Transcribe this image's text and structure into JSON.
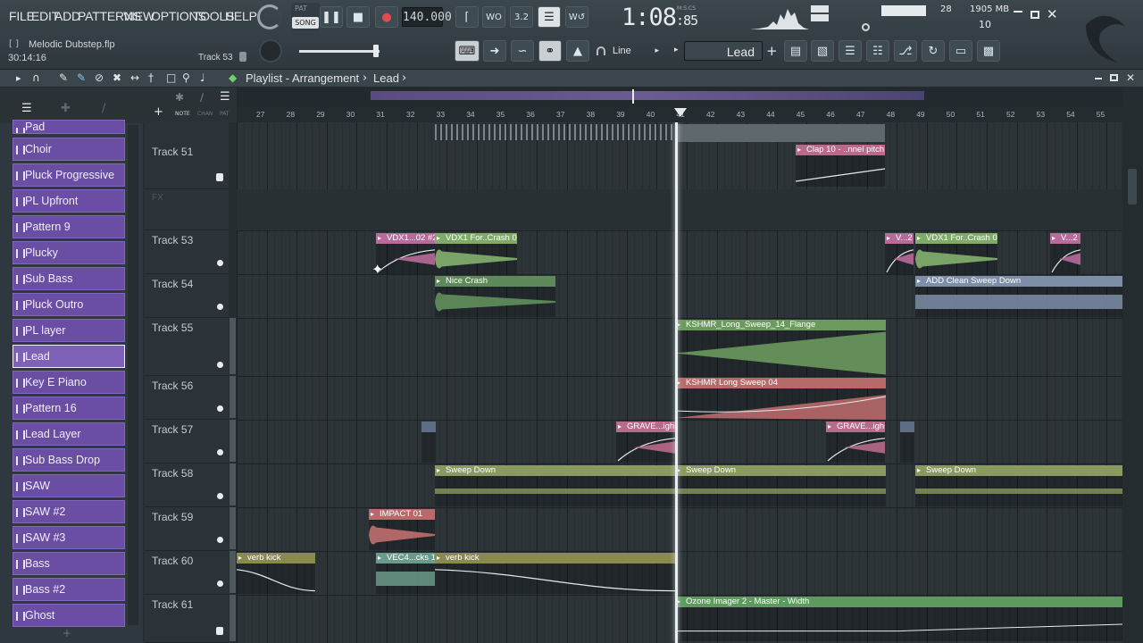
{
  "menu": [
    "FILE",
    "EDIT",
    "ADD",
    "PATTERNS",
    "VIEW",
    "OPTIONS",
    "TOOLS",
    "HELP"
  ],
  "transport": {
    "pat": "PAT",
    "song": "SONG",
    "tempo": "140.000",
    "time_main": "1:08",
    "time_small": "85",
    "time_label": "M:S:CS"
  },
  "file": {
    "name": "Melodic Dubstep.flp",
    "brackets": "[ ]",
    "time": "30:14:16",
    "track": "Track 53"
  },
  "stats": {
    "cpu": "28",
    "mem": "1905 MB",
    "poly": "10"
  },
  "toolbar": {
    "snap": "Line",
    "channel": "Lead",
    "plus": "+"
  },
  "playlist": {
    "title": "Playlist - Arrangement",
    "pattern": "Lead",
    "sep": "›"
  },
  "panel_tabs": {
    "note": "NOTE",
    "chan": "CHAN",
    "pat": "PAT",
    "add": "+"
  },
  "patterns": [
    {
      "label": "Pad"
    },
    {
      "label": "Choir"
    },
    {
      "label": "Pluck Progressive"
    },
    {
      "label": "PL Upfront"
    },
    {
      "label": "Pattern 9"
    },
    {
      "label": "Plucky"
    },
    {
      "label": "Sub Bass"
    },
    {
      "label": "Pluck Outro"
    },
    {
      "label": "PL layer"
    },
    {
      "label": "Lead",
      "selected": true
    },
    {
      "label": "Key E Piano"
    },
    {
      "label": "Pattern 16"
    },
    {
      "label": "Lead Layer"
    },
    {
      "label": "Sub Bass Drop"
    },
    {
      "label": "SAW"
    },
    {
      "label": "SAW #2"
    },
    {
      "label": "SAW #3"
    },
    {
      "label": "Bass"
    },
    {
      "label": "Bass #2"
    },
    {
      "label": "Ghost"
    }
  ],
  "tracks": [
    {
      "label": "Track 51"
    },
    {
      "label": "FX"
    },
    {
      "label": "Track 53"
    },
    {
      "label": "Track 54"
    },
    {
      "label": "Track 55"
    },
    {
      "label": "Track 56"
    },
    {
      "label": "Track 57"
    },
    {
      "label": "Track 58"
    },
    {
      "label": "Track 59"
    },
    {
      "label": "Track 60"
    },
    {
      "label": "Track 61"
    }
  ],
  "ruler": [
    "27",
    "28",
    "29",
    "30",
    "31",
    "32",
    "33",
    "34",
    "35",
    "36",
    "37",
    "38",
    "39",
    "40",
    "41",
    "42",
    "43",
    "44",
    "45",
    "46",
    "47",
    "48",
    "49",
    "50",
    "51",
    "52",
    "53",
    "54",
    "55"
  ],
  "clips": [
    {
      "label": "Clap 10 - ..nnel pitch",
      "color": "#b86a8a"
    },
    {
      "label": "VDX1...02 #2",
      "color": "#b86a9a"
    },
    {
      "label": "VDX1 For..Crash 02",
      "color": "#7faa6a"
    },
    {
      "label": "V...2",
      "color": "#b86a9a"
    },
    {
      "label": "VDX1 For..Crash 02",
      "color": "#7faa6a"
    },
    {
      "label": "V...2",
      "color": "#b86a9a"
    },
    {
      "label": "Nice Crash",
      "color": "#5e8a5a"
    },
    {
      "label": "ADD Clean Sweep Down",
      "color": "#7e8ea8"
    },
    {
      "label": "KSHMR_Long_Sweep_14_Flange",
      "color": "#6a9a5e"
    },
    {
      "label": "KSHMR Long Sweep 04",
      "color": "#b86a6a"
    },
    {
      "label": "GRAVE...ighs",
      "color": "#b86a8a"
    },
    {
      "label": "GRAVE...ighs",
      "color": "#b86a8a"
    },
    {
      "label": "Sweep Down",
      "color": "#8a9a5e"
    },
    {
      "label": "Sweep Down",
      "color": "#8a9a5e"
    },
    {
      "label": "Sweep Down",
      "color": "#8a9a5e"
    },
    {
      "label": "IMPACT 01",
      "color": "#b86a6a"
    },
    {
      "label": "verb kick",
      "color": "#8a8a4e"
    },
    {
      "label": "VEC4...cks 19",
      "color": "#6a9a8a"
    },
    {
      "label": "verb kick",
      "color": "#8a8a4e"
    },
    {
      "label": "Ozone Imager 2 - Master - Width",
      "color": "#5e9a5e"
    }
  ]
}
